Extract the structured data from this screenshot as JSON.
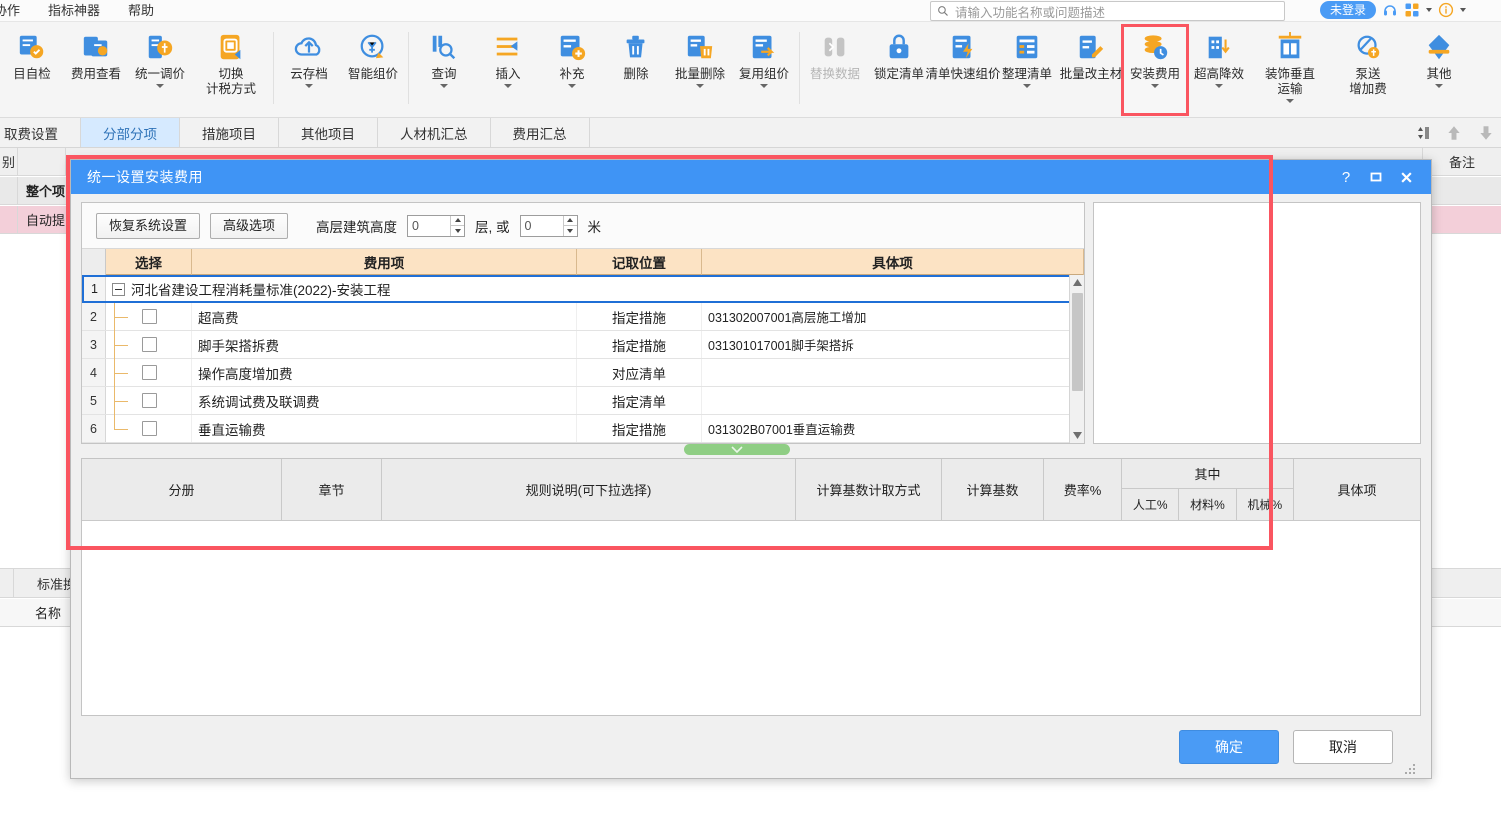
{
  "menubar": {
    "items": [
      "协作",
      "指标神器",
      "帮助"
    ],
    "search": {
      "placeholder": "请输入功能名称或问题描述",
      "icon": "search-icon"
    },
    "account": {
      "login_label": "未登录",
      "icons": [
        "headset-icon",
        "apps-grid-icon",
        "info-circle-icon"
      ]
    }
  },
  "ribbon": {
    "buttons": [
      {
        "label": "目自检",
        "icon": "self-check-icon",
        "caret": false,
        "disabled": false
      },
      {
        "label": "费用查看",
        "icon": "cost-view-icon",
        "caret": false,
        "disabled": false
      },
      {
        "label": "统一调价",
        "icon": "unified-price-icon",
        "caret": true,
        "disabled": false
      },
      {
        "label": "切换\n计税方式",
        "icon": "switch-tax-icon",
        "caret": false,
        "disabled": false
      },
      {
        "label": "云存档",
        "icon": "cloud-archive-icon",
        "caret": true,
        "disabled": false
      },
      {
        "label": "智能组价",
        "icon": "smart-pricing-icon",
        "caret": false,
        "disabled": false
      },
      {
        "label": "查询",
        "icon": "query-icon",
        "caret": true,
        "disabled": false
      },
      {
        "label": "插入",
        "icon": "insert-icon",
        "caret": true,
        "disabled": false
      },
      {
        "label": "补充",
        "icon": "supplement-icon",
        "caret": true,
        "disabled": false
      },
      {
        "label": "删除",
        "icon": "delete-trash-icon",
        "caret": false,
        "disabled": false
      },
      {
        "label": "批量删除",
        "icon": "batch-delete-icon",
        "caret": true,
        "disabled": false
      },
      {
        "label": "复用组价",
        "icon": "reuse-price-icon",
        "caret": true,
        "disabled": false
      },
      {
        "label": "替换数据",
        "icon": "replace-data-icon",
        "caret": false,
        "disabled": true
      },
      {
        "label": "锁定清单",
        "icon": "lock-list-icon",
        "caret": false,
        "disabled": false
      },
      {
        "label": "清单快速组价",
        "icon": "quick-pricing-icon",
        "caret": false,
        "disabled": false
      },
      {
        "label": "整理清单",
        "icon": "organize-list-icon",
        "caret": true,
        "disabled": false
      },
      {
        "label": "批量改主材",
        "icon": "batch-material-icon",
        "caret": false,
        "disabled": false
      },
      {
        "label": "安装费用",
        "icon": "install-cost-icon",
        "caret": true,
        "disabled": false,
        "highlighted": true
      },
      {
        "label": "超高降效",
        "icon": "super-high-icon",
        "caret": true,
        "disabled": false
      },
      {
        "label": "装饰垂直\n运输",
        "icon": "vertical-transport-icon",
        "caret": true,
        "disabled": false
      },
      {
        "label": "泵送\n增加费",
        "icon": "pump-fee-icon",
        "caret": false,
        "disabled": false
      },
      {
        "label": "其他",
        "icon": "other-icon",
        "caret": true,
        "disabled": false
      }
    ]
  },
  "tabs": {
    "items": [
      {
        "label": "取费设置",
        "active": false
      },
      {
        "label": "分部分项",
        "active": true
      },
      {
        "label": "措施项目",
        "active": false
      },
      {
        "label": "其他项目",
        "active": false
      },
      {
        "label": "人材机汇总",
        "active": false
      },
      {
        "label": "费用汇总",
        "active": false
      }
    ],
    "tools": [
      "sort-toggle-icon",
      "move-up-icon",
      "move-down-icon"
    ]
  },
  "background": {
    "header_cells": [
      "别",
      "",
      "",
      "备注"
    ],
    "row_project": "整个项",
    "row_auto": "自动提",
    "lower_header": [
      "标准换",
      ""
    ],
    "lower_sub": [
      "名称"
    ]
  },
  "dialog": {
    "title": "统一设置安装费用",
    "titlebar_buttons": [
      {
        "name": "help-button",
        "glyph": "?"
      },
      {
        "name": "maximize-button",
        "glyph": "▢"
      },
      {
        "name": "close-button",
        "glyph": "✕"
      }
    ],
    "options": {
      "restore_button": "恢复系统设置",
      "advanced_button": "高级选项",
      "height_label": "高层建筑高度",
      "floors_value": "0",
      "floors_unit": "层, 或",
      "meters_value": "0",
      "meters_unit": "米"
    },
    "top_table": {
      "columns": [
        "",
        "选择",
        "费用项",
        "记取位置",
        "具体项"
      ],
      "rows": [
        {
          "no": "1",
          "type": "group",
          "expanded": true,
          "name": "河北省建设工程消耗量标准(2022)-安装工程",
          "position": "",
          "detail": "",
          "selected": true
        },
        {
          "no": "2",
          "type": "leaf",
          "checked": false,
          "name": "超高费",
          "position": "指定措施",
          "detail": "031302007001高层施工增加"
        },
        {
          "no": "3",
          "type": "leaf",
          "checked": false,
          "name": "脚手架搭拆费",
          "position": "指定措施",
          "detail": "031301017001脚手架搭拆"
        },
        {
          "no": "4",
          "type": "leaf",
          "checked": false,
          "name": "操作高度增加费",
          "position": "对应清单",
          "detail": ""
        },
        {
          "no": "5",
          "type": "leaf",
          "checked": false,
          "name": "系统调试费及联调费",
          "position": "指定清单",
          "detail": ""
        },
        {
          "no": "6",
          "type": "leaf",
          "checked": false,
          "name": "垂直运输费",
          "position": "指定措施",
          "detail": "031302B07001垂直运输费"
        }
      ]
    },
    "bottom_table": {
      "columns": [
        "分册",
        "章节",
        "规则说明(可下拉选择)",
        "计算基数计取方式",
        "计算基数",
        "费率%",
        "具体项"
      ],
      "group_header": "其中",
      "group_sub": [
        "人工%",
        "材料%",
        "机械%"
      ],
      "rows": []
    },
    "footer": {
      "ok": "确定",
      "cancel": "取消"
    }
  },
  "colors": {
    "accent_blue": "#4a9bf5",
    "title_blue": "#3f94f5",
    "highlight_red": "#fa5560",
    "table_header_orange": "#fce3c4",
    "splitter_green": "#8fce84",
    "tab_active_bg": "#d6eaff",
    "tree_line": "#eab96a"
  }
}
